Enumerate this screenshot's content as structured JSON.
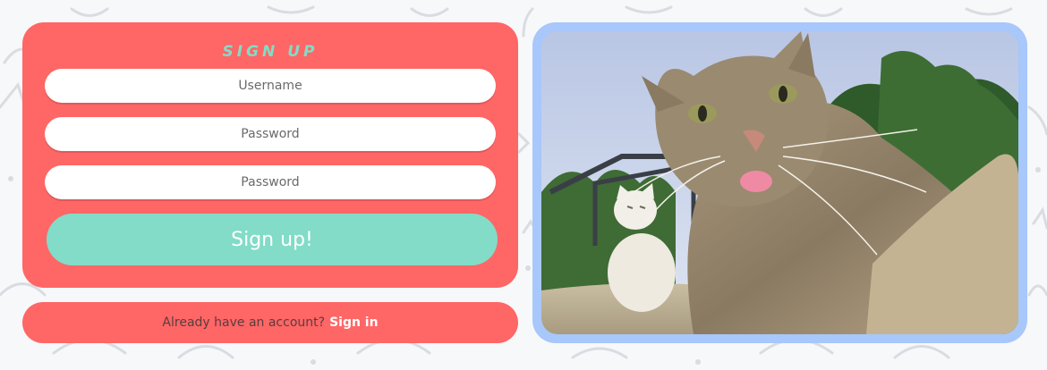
{
  "signup": {
    "title": "SIGN UP",
    "username_placeholder": "Username",
    "password_placeholder": "Password",
    "confirm_placeholder": "Password",
    "submit_label": "Sign up!"
  },
  "signin": {
    "prompt": "Already have an account?",
    "link_label": "Sign in"
  },
  "image": {
    "semantic": "cat-selfie-photo"
  },
  "colors": {
    "card": "#ff6666",
    "accent": "#82dcc7",
    "frame": "#a8c7fa",
    "background": "#f7f8fa"
  }
}
